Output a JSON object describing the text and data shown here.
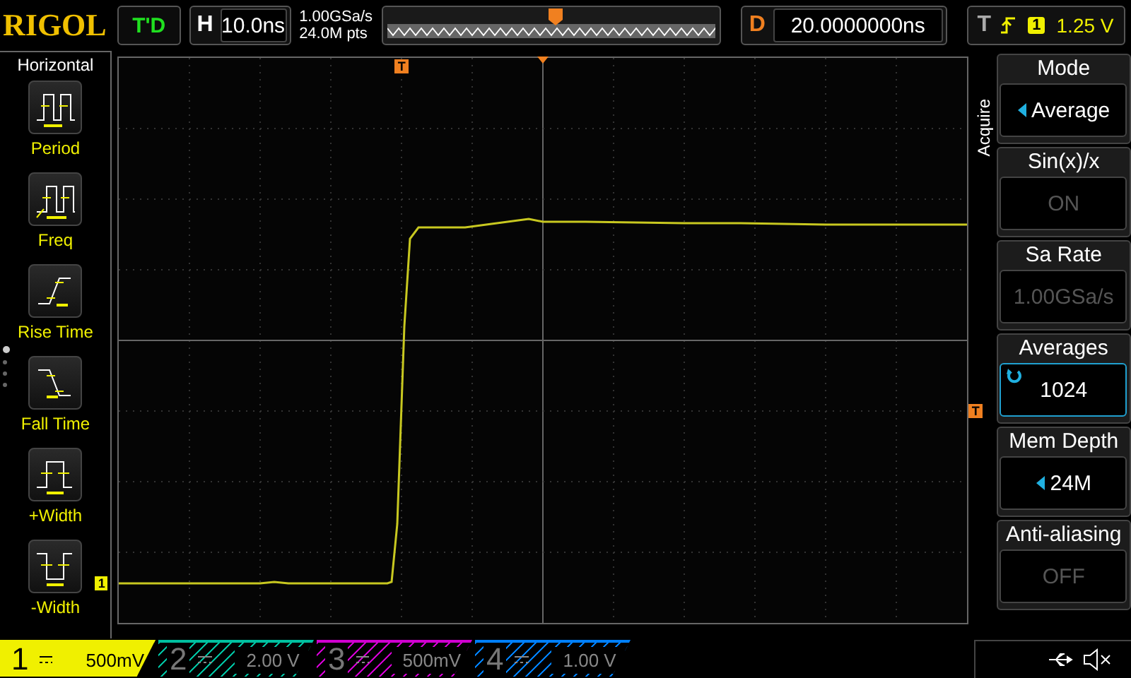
{
  "top_bar": {
    "logo": "RIGOL",
    "run_status": "T'D",
    "timebase": {
      "label": "H",
      "value": "10.0ns"
    },
    "sample_rate": "1.00GSa/s",
    "memory_points": "24.0M pts",
    "delay": {
      "label": "D",
      "value": "20.0000000ns"
    },
    "trigger": {
      "label": "T",
      "source": "1",
      "level": "1.25 V"
    }
  },
  "left_menu": {
    "title": "Horizontal",
    "items": [
      {
        "label": "Period",
        "kind": "period"
      },
      {
        "label": "Freq",
        "kind": "freq"
      },
      {
        "label": "Rise Time",
        "kind": "rise"
      },
      {
        "label": "Fall Time",
        "kind": "fall"
      },
      {
        "label": "+Width",
        "kind": "pwidth"
      },
      {
        "label": "-Width",
        "kind": "nwidth"
      }
    ],
    "pages": [
      {
        "selected": true
      },
      {
        "selected": false
      },
      {
        "selected": false
      },
      {
        "selected": false
      }
    ]
  },
  "markers": {
    "trigger_position": "T",
    "trigger_level": "T",
    "channel": "1"
  },
  "right_menu": {
    "title": "Acquire",
    "items": [
      {
        "label": "Mode",
        "value": "Average",
        "kind": "select"
      },
      {
        "label": "Sin(x)/x",
        "value": "ON",
        "kind": "disabled"
      },
      {
        "label": "Sa Rate",
        "value": "1.00GSa/s",
        "kind": "disabled"
      },
      {
        "label": "Averages",
        "value": "1024",
        "kind": "knob"
      },
      {
        "label": "Mem Depth",
        "value": "24M",
        "kind": "select"
      },
      {
        "label": "Anti-aliasing",
        "value": "OFF",
        "kind": "disabled"
      }
    ]
  },
  "channels": [
    {
      "number": "1",
      "scale": "500mV",
      "color": "#f0f000",
      "active": true
    },
    {
      "number": "2",
      "scale": "2.00 V",
      "color": "#00c0a0",
      "active": false
    },
    {
      "number": "3",
      "scale": "500mV",
      "color": "#d000d0",
      "active": false
    },
    {
      "number": "4",
      "scale": "1.00 V",
      "color": "#0080ff",
      "active": false
    }
  ]
}
